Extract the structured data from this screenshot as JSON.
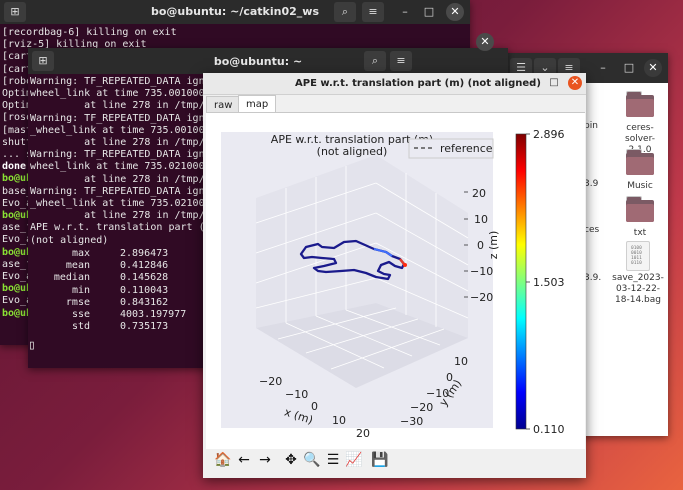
{
  "terminal_back": {
    "title": "bo@ubuntu: ~/catkin02_ws",
    "lines": [
      {
        "text": "[recordbag-6] killing on exit",
        "style": ""
      },
      {
        "text": "[rviz-5] killing on exit",
        "style": ""
      },
      {
        "text": "[cart",
        "style": ""
      },
      {
        "text": "[cart",
        "style": ""
      },
      {
        "text": "[robo",
        "style": ""
      },
      {
        "text": "Optim",
        "style": ""
      },
      {
        "text": "Optim",
        "style": ""
      },
      {
        "text": "[roso",
        "style": ""
      },
      {
        "text": "[mast",
        "style": ""
      },
      {
        "text": "shutt",
        "style": ""
      },
      {
        "text": "... s",
        "style": ""
      },
      {
        "text": "done",
        "style": "wb"
      },
      {
        "text": "bo@ub",
        "style": "g"
      },
      {
        "text": "base_",
        "style": ""
      },
      {
        "text": "Evo_a",
        "style": ""
      },
      {
        "text": "bo@ub",
        "style": "g"
      },
      {
        "text": "ase_f",
        "style": ""
      },
      {
        "text": "Evo_a",
        "style": ""
      },
      {
        "text": "bo@ub",
        "style": "g"
      },
      {
        "text": "ase_f",
        "style": ""
      },
      {
        "text": "Evo_a",
        "style": ""
      },
      {
        "text": "bo@ub",
        "style": "g"
      },
      {
        "text": "Evo_a",
        "style": ""
      },
      {
        "text": "bo@ub",
        "style": "g"
      }
    ]
  },
  "terminal_front": {
    "title": "bo@ubuntu: ~",
    "warning_lines": [
      "Warning: TF_REPEATED_DATA igno",
      "wheel_link at time 735.001000",
      "         at line 278 in /tmp/b",
      "Warning: TF_REPEATED_DATA igno",
      "_wheel_link at time 735.001000",
      "         at line 278 in /tmp/b",
      "Warning: TF_REPEATED_DATA igno",
      "wheel_link at time 735.021000",
      "         at line 278 in /tmp/b",
      "Warning: TF_REPEATED_DATA igno",
      "_wheel_link at time 735.021000",
      "         at line 278 in /tmp/b",
      "APE w.r.t. translation part (m",
      "(not aligned)"
    ],
    "stats": [
      {
        "label": "max",
        "value": "2.896473"
      },
      {
        "label": "mean",
        "value": "0.412846"
      },
      {
        "label": "median",
        "value": "0.145628"
      },
      {
        "label": "min",
        "value": "0.110043"
      },
      {
        "label": "rmse",
        "value": "0.843162"
      },
      {
        "label": "sse",
        "value": "4003.197977"
      },
      {
        "label": "std",
        "value": "0.735173"
      }
    ],
    "cursor": "▯"
  },
  "file_manager": {
    "partial_labels": [
      "pin",
      "3.9",
      "ces",
      "3.9."
    ],
    "items": [
      {
        "name": "ceres-",
        "name2": "solver-2.1.0",
        "type": "folder"
      },
      {
        "name": "Music",
        "name2": "",
        "type": "folder"
      },
      {
        "name": "txt",
        "name2": "",
        "type": "folder"
      },
      {
        "name": "save_2023-",
        "name2": "03-12-22-",
        "name3": "18-14.bag",
        "type": "file"
      }
    ],
    "bag_icon_text": "0100\n0010\n1011\n0110"
  },
  "plot_window": {
    "title": "APE w.r.t. translation part (m) (not aligned)",
    "tabs": [
      "raw",
      "map"
    ],
    "active_tab": "map",
    "toolbar": [
      "home-icon",
      "back-icon",
      "forward-icon",
      "pan-icon",
      "zoom-icon",
      "configure-subplots-icon",
      "edit-axis-icon",
      "save-icon"
    ],
    "toolbar_glyphs": [
      "🏠",
      "←",
      "→",
      "✥",
      "🔍",
      "☰",
      "📈",
      "💾"
    ]
  },
  "chart_data": {
    "type": "line",
    "title": "APE w.r.t. translation part (m)\n(not aligned)",
    "legend": [
      "reference"
    ],
    "legend_position": "top-right",
    "xlabel": "x (m)",
    "ylabel": "y (m)",
    "zlabel": "z (m)",
    "x_ticks": [
      "−20",
      "−10",
      "0",
      "10",
      "20"
    ],
    "y_ticks": [
      "10",
      "0",
      "−10",
      "−20",
      "−30"
    ],
    "z_ticks": [
      "20",
      "10",
      "0",
      "−10",
      "−20"
    ],
    "colorbar": {
      "max": "2.896",
      "mid": "1.503",
      "min": "0.110",
      "colormap": "jet"
    },
    "grid": true,
    "series": [
      {
        "name": "reference",
        "style": "dashed",
        "color": "#555555"
      }
    ]
  }
}
